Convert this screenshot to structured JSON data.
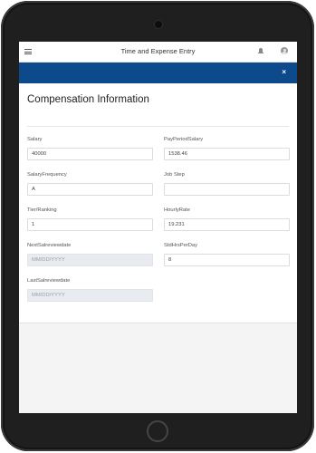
{
  "header": {
    "title": "Time and Expense Entry",
    "menu_icon": "hamburger-menu-icon",
    "notification_icon": "bell-icon",
    "user_icon": "user-avatar-icon"
  },
  "banner": {
    "close_label": "×",
    "color": "#0c4a8b"
  },
  "section": {
    "title": "Compensation Information"
  },
  "fields": {
    "salary": {
      "label": "Salary",
      "value": "40000"
    },
    "pay_period_salary": {
      "label": "PayPeriodSalary",
      "value": "1538.46"
    },
    "salary_frequency": {
      "label": "SalaryFrequency",
      "value": "A"
    },
    "job_step": {
      "label": "Job Step",
      "value": ""
    },
    "tier_ranking": {
      "label": "Tier/Ranking",
      "value": "1"
    },
    "hourly_rate": {
      "label": "HourlyRate",
      "value": "19.231"
    },
    "next_salary_review_date": {
      "label": "NextSalreviewdate",
      "placeholder": "MM/DD/YYYY"
    },
    "std_hrs_per_day": {
      "label": "StdHrsPerDay",
      "value": "8"
    },
    "last_salary_review_date": {
      "label": "LastSalreviewdate",
      "placeholder": "MM/DD/YYYY"
    }
  }
}
